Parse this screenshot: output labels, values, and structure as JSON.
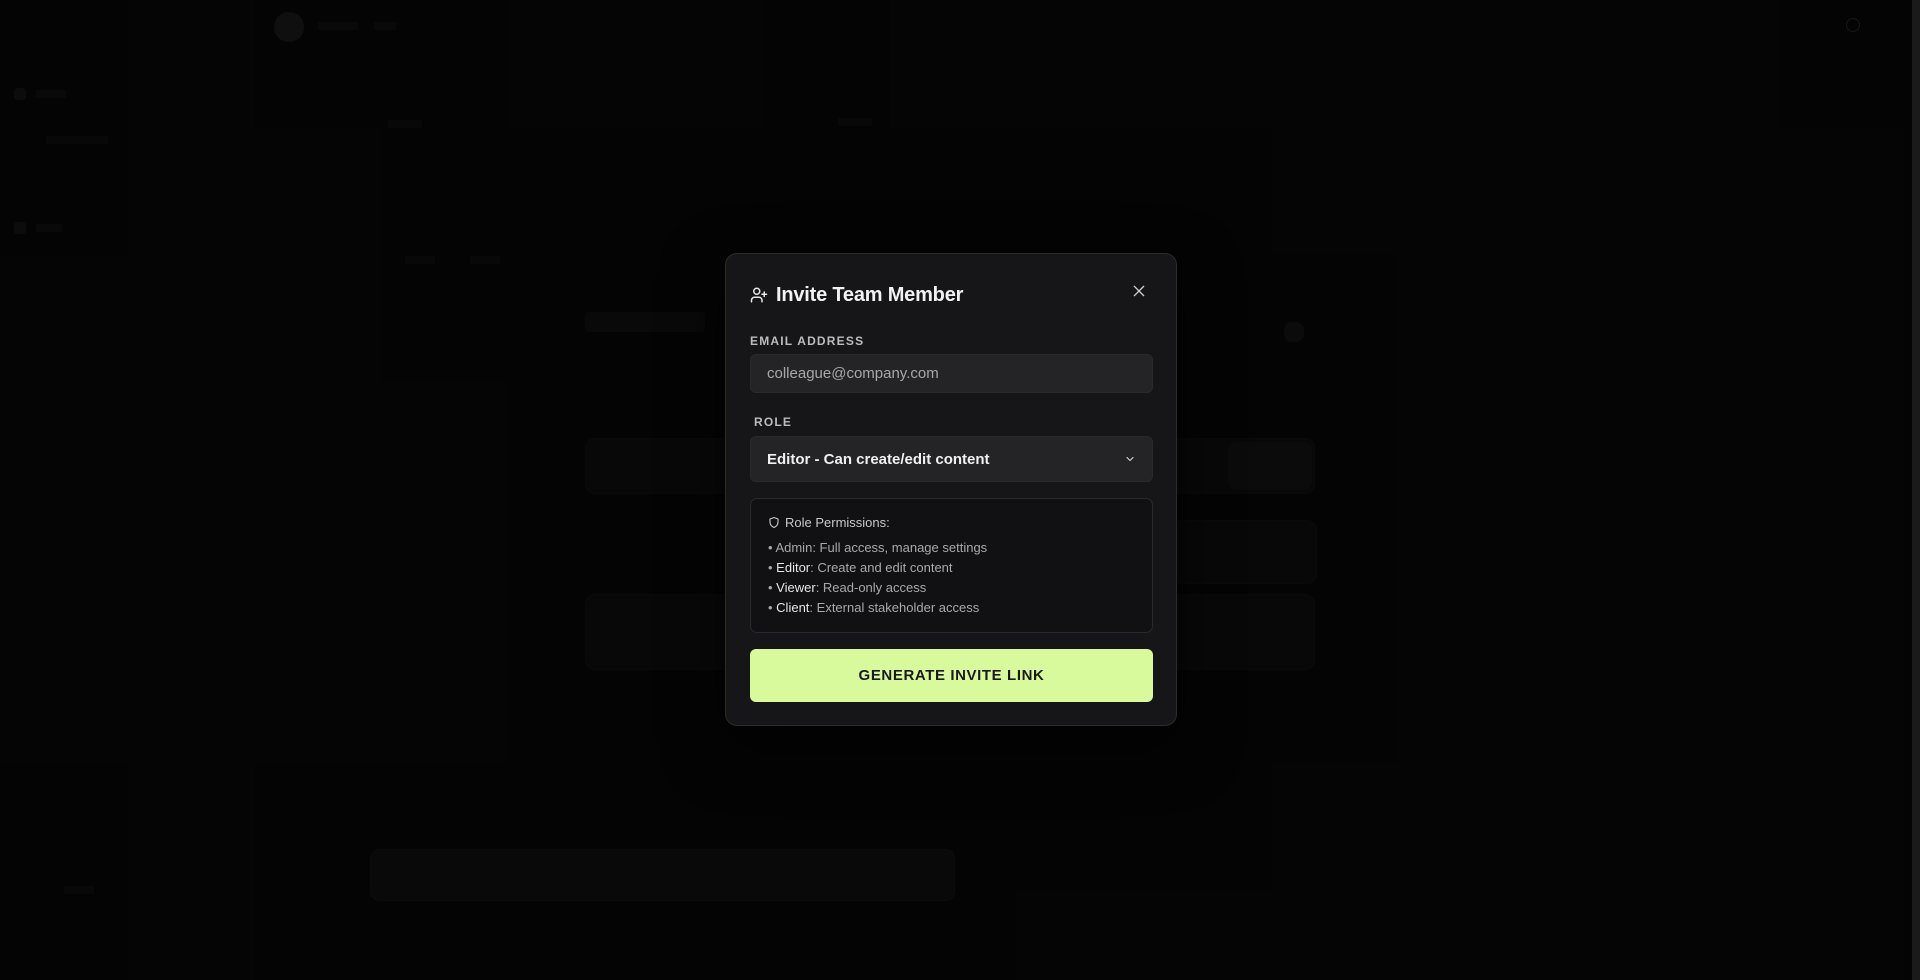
{
  "modal": {
    "title": "Invite Team Member",
    "email_label": "EMAIL ADDRESS",
    "email_placeholder": "colleague@company.com",
    "email_value": "",
    "role_label": "ROLE",
    "role_selected": "Editor - Can create/edit content",
    "permissions": {
      "heading": "Role Permissions:",
      "items": [
        {
          "role": "Admin",
          "desc": ": Full access, manage settings"
        },
        {
          "role": "Editor",
          "desc": ": Create and edit content"
        },
        {
          "role": "Viewer",
          "desc": ": Read-only access"
        },
        {
          "role": "Client",
          "desc": ": External stakeholder access"
        }
      ]
    },
    "generate_button": "GENERATE INVITE LINK"
  },
  "colors": {
    "accent": "#d9f99d",
    "modal_bg": "#161618",
    "page_bg": "#000000"
  },
  "icons": {
    "title_icon": "user-plus-icon",
    "close": "close-icon",
    "select": "chevron-down-icon",
    "permissions": "shield-icon"
  }
}
